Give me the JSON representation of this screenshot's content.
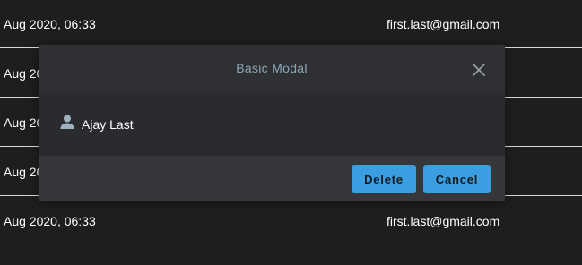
{
  "rows": [
    {
      "date": "Aug 2020, 06:33",
      "email": "first.last@gmail.com"
    },
    {
      "date": "Aug 20",
      "email": ""
    },
    {
      "date": "Aug 20",
      "email": ""
    },
    {
      "date": "Aug 20",
      "email": ""
    },
    {
      "date": "Aug 2020, 06:33",
      "email": "first.last@gmail.com"
    }
  ],
  "modal": {
    "title": "Basic Modal",
    "close_icon": "close-icon",
    "user_icon": "user-icon",
    "user_name": "Ajay Last",
    "delete_label": "Delete",
    "cancel_label": "Cancel"
  },
  "colors": {
    "background": "#1e1e1e",
    "modal": "#2b2c2e",
    "accent": "#3a9ee0",
    "title": "#8ba6b6"
  }
}
